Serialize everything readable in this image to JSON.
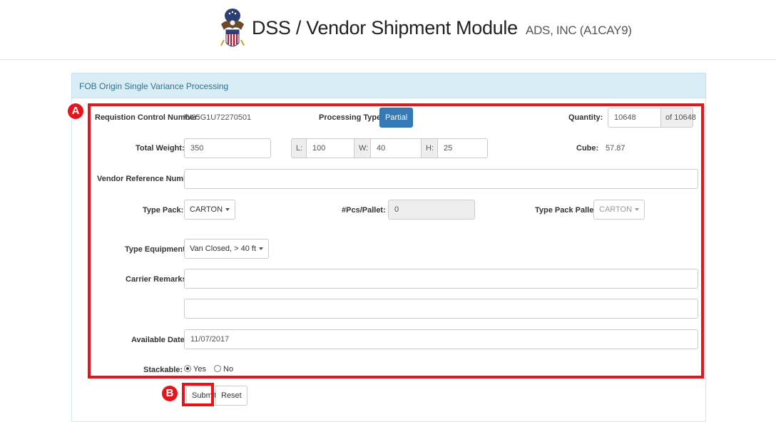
{
  "header": {
    "title": "DSS / Vendor Shipment Module",
    "company": "ADS, INC (A1CAY9)",
    "logo_icon": "dla-eagle-seal-icon"
  },
  "panel": {
    "heading": "FOB Origin Single Variance Processing"
  },
  "form": {
    "requisition_label": "Requistion Control Number:",
    "requisition_value": "W25G1U72270501",
    "processing_type_label": "Processing Type:",
    "processing_type_value": "Partial",
    "quantity_label": "Quantity:",
    "quantity_value": "10648",
    "quantity_total": "of 10648",
    "total_weight_label": "Total Weight:",
    "total_weight_value": "350",
    "length_label": "L:",
    "length_value": "100",
    "width_label": "W:",
    "width_value": "40",
    "height_label": "H:",
    "height_value": "25",
    "cube_label": "Cube:",
    "cube_value": "57.87",
    "vendor_ref_label": "Vendor Reference Number:",
    "vendor_ref_value": "",
    "type_pack_label": "Type Pack:",
    "type_pack_value": "CARTON",
    "pcs_pallet_label": "#Pcs/Pallet:",
    "pcs_pallet_value": "0",
    "type_pack_pallet_label": "Type Pack Pallet:",
    "type_pack_pallet_value": "CARTON",
    "type_equipment_label": "Type Equipment:",
    "type_equipment_value": "Van Closed, > 40 ft",
    "carrier_remarks_label": "Carrier Remarks:",
    "carrier_remarks_1": "",
    "carrier_remarks_2": "",
    "available_date_label": "Available Date:",
    "available_date_value": "11/07/2017",
    "stackable_label": "Stackable:",
    "stackable_yes": "Yes",
    "stackable_no": "No",
    "stackable_selected": "Yes"
  },
  "actions": {
    "submit_label": "Submit",
    "reset_label": "Reset"
  },
  "annotations": {
    "marker_a": "A",
    "marker_b": "B",
    "highlight_color": "#e8141b"
  },
  "colors": {
    "primary_button": "#337ab7",
    "panel_heading_bg": "#d9edf7",
    "panel_heading_text": "#31708f"
  }
}
